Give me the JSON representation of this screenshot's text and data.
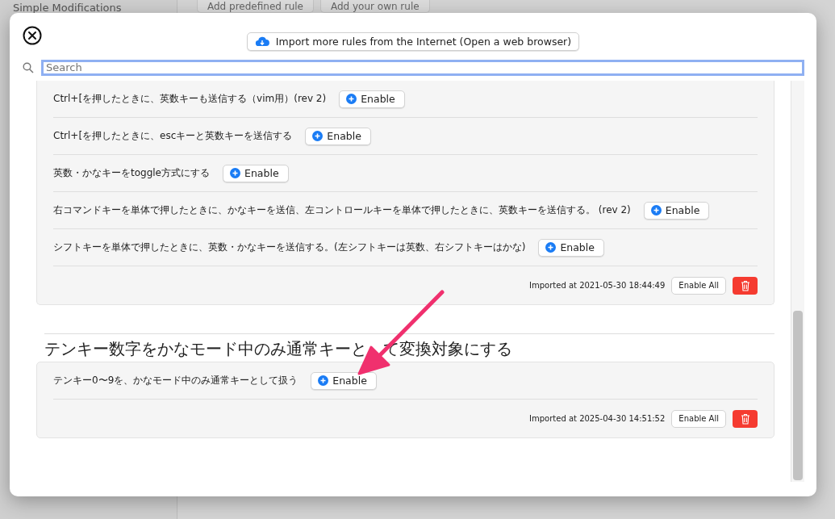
{
  "background": {
    "sidebar_title": "Simple Modifications",
    "toolbar_buttons": [
      "Add predefined rule",
      "Add your own rule"
    ]
  },
  "dialog": {
    "import_button": "Import more rules from the Internet (Open a web browser)",
    "search": {
      "placeholder": "Search",
      "focused": true
    },
    "groups": [
      {
        "rules": [
          {
            "description": "Ctrl+[を押したときに、英数キーも送信する（vim用）(rev 2)",
            "button": "Enable"
          },
          {
            "description": "Ctrl+[を押したときに、escキーと英数キーを送信する",
            "button": "Enable"
          },
          {
            "description": "英数・かなキーをtoggle方式にする",
            "button": "Enable"
          },
          {
            "description": "右コマンドキーを単体で押したときに、かなキーを送信、左コントロールキーを単体で押したときに、英数キーを送信する。 (rev 2)",
            "button": "Enable"
          },
          {
            "description": "シフトキーを単体で押したときに、英数・かなキーを送信する。(左シフトキーは英数、右シフトキーはかな)",
            "button": "Enable"
          }
        ],
        "imported": "Imported at 2021-05-30 18:44:49",
        "enable_all": "Enable All"
      },
      {
        "title_parts": [
          "テンキー数字をかなモード中のみ通常キーと",
          "て変換対象にする"
        ],
        "rules": [
          {
            "description": "テンキー0〜9を、かなモード中のみ通常キーとして扱う",
            "button": "Enable"
          }
        ],
        "imported": "Imported at 2025-04-30 14:51:52",
        "enable_all": "Enable All"
      }
    ]
  }
}
